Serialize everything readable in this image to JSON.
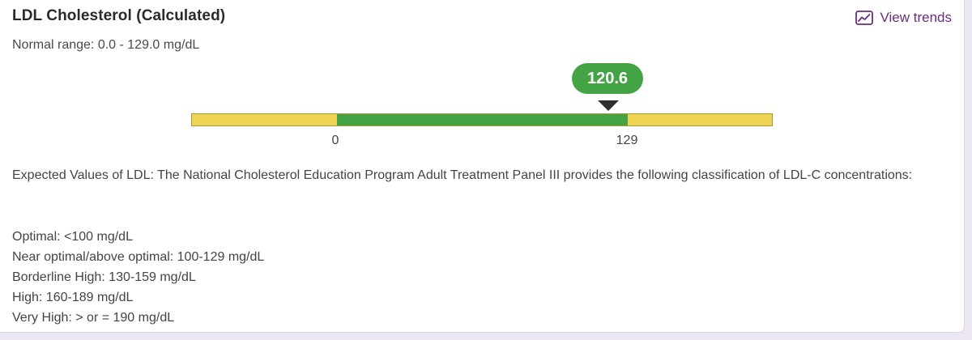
{
  "card": {
    "title": "LDL Cholesterol (Calculated)",
    "normal_range": "Normal range: 0.0 - 129.0 mg/dL",
    "view_trends_label": "View trends",
    "trends_icon": "trend-chart-icon"
  },
  "gauge": {
    "value_label": "120.6",
    "value": 120.6,
    "range_min": 0,
    "range_max": 129,
    "min_label": "0",
    "max_label": "129",
    "colors": {
      "in_range": "#43a345",
      "out_of_range": "#efd453",
      "marker": "#2e2e2e"
    }
  },
  "description": "Expected Values of LDL: The National Cholesterol Education Program Adult Treatment Panel III provides the following classification of LDL-C concentrations:",
  "classifications": [
    "Optimal: <100 mg/dL",
    "Near optimal/above optimal: 100-129 mg/dL",
    "Borderline High: 130-159 mg/dL",
    "High: 160-189 mg/dL",
    "Very High: > or = 190 mg/dL"
  ],
  "colors": {
    "accent": "#6b2d7a",
    "page_background": "#ebe6ef"
  }
}
